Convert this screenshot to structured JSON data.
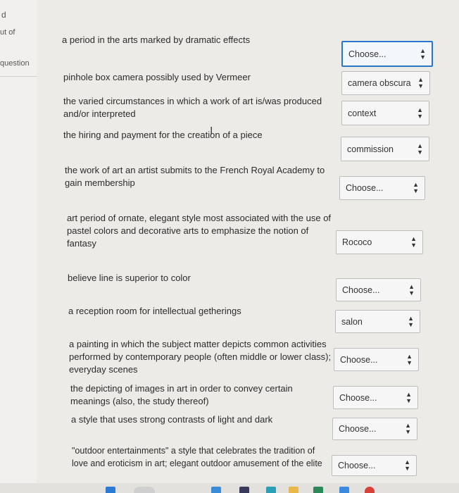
{
  "sidebar": {
    "top_fragment": "d",
    "out_of": "ut of",
    "question": "question"
  },
  "questions": [
    {
      "text": "a period in the arts marked by dramatic effects",
      "answer": "Choose...",
      "focused": true
    },
    {
      "text": "pinhole box camera possibly used by Vermeer",
      "answer": "camera obscura"
    },
    {
      "text": "the varied circumstances in which a work of art is/was produced and/or interpreted",
      "answer": "context"
    },
    {
      "text": "the hiring and payment for the creation of a piece",
      "answer": "commission"
    },
    {
      "text": "the work of art an artist submits to the French Royal Academy to gain membership",
      "answer": "Choose..."
    },
    {
      "text": "art period of ornate, elegant style most associated with the use of pastel colors and decorative arts to emphasize the notion of fantasy",
      "answer": "Rococo"
    },
    {
      "text": "believe line is superior to color",
      "answer": "Choose..."
    },
    {
      "text": "a reception room for intellectual getherings",
      "answer": "salon"
    },
    {
      "text": "a painting in which the subject matter depicts common activities performed by contemporary people (often middle or lower class); everyday scenes",
      "answer": "Choose..."
    },
    {
      "text": "the depicting of images in art in order to convey certain meanings (also, the study thereof)",
      "answer": "Choose..."
    },
    {
      "text": "a style that uses strong contrasts of light and dark",
      "answer": "Choose..."
    },
    {
      "text": "\"outdoor entertainments\" a style that celebrates the tradition of love and eroticism in art; elegant outdoor amusement of the elite",
      "answer": "Choose..."
    }
  ],
  "colors": {
    "focus_border": "#2a77c9"
  },
  "icons": {
    "select_arrow": "updown-chevron-icon",
    "cursor": "text-cursor-icon"
  }
}
